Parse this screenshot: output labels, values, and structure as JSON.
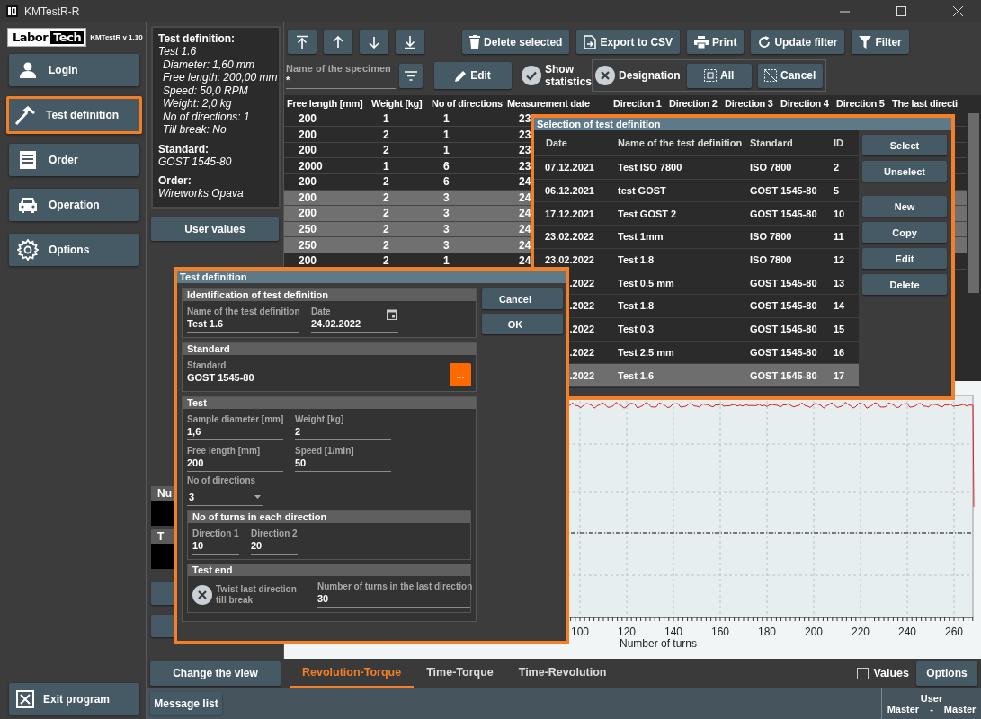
{
  "window": {
    "title": "KMTestR-R"
  },
  "logo": {
    "words": [
      "Labor",
      "Tech"
    ],
    "version": "KMTestR v 1.10"
  },
  "nav": [
    {
      "label": "Login",
      "highlighted": false
    },
    {
      "label": "Test definition",
      "highlighted": true
    },
    {
      "label": "Order",
      "highlighted": false
    },
    {
      "label": "Operation",
      "highlighted": false
    },
    {
      "label": "Options",
      "highlighted": false
    }
  ],
  "exit_button": "Exit program",
  "info_panel": [
    {
      "heading": "Test definition:",
      "value": "Test 1.6",
      "children": [
        "Diameter:  1,60 mm",
        "Free length:  200,00 mm",
        "Speed:  50,0 RPM",
        "Weight:  2,0 kg",
        "No of directions:  1",
        "Till break:  No"
      ]
    },
    {
      "heading": "Standard:",
      "value": "GOST 1545-80"
    },
    {
      "heading": "Order:",
      "value": "Wireworks Opava"
    }
  ],
  "user_values_button": "User values",
  "side_labels": [
    "Nu",
    "T"
  ],
  "toolbar": {
    "buttons": [
      "Delete selected",
      "Export to CSV",
      "Print",
      "Update filter",
      "Filter"
    ]
  },
  "filter_row": {
    "specimen_field": {
      "label": "Name of the specimen",
      "value": "*"
    },
    "edit_button": "Edit",
    "show_statistics": {
      "label": "Show statistics",
      "checked": true
    },
    "designation": {
      "label": "Designation",
      "checked": false
    },
    "all_button": "All",
    "cancel_button": "Cancel"
  },
  "table": {
    "columns": [
      "Free length [mm]",
      "Weight [kg]",
      "No of directions",
      "Measurement date",
      "Direction 1",
      "Direction 2",
      "Direction 3",
      "Direction 4",
      "Direction 5",
      "The last directi"
    ],
    "rows": [
      {
        "cells": [
          "200",
          "1",
          "1",
          "23"
        ],
        "selected": false
      },
      {
        "cells": [
          "200",
          "2",
          "1",
          "23"
        ],
        "selected": false
      },
      {
        "cells": [
          "200",
          "2",
          "1",
          "23"
        ],
        "selected": false
      },
      {
        "cells": [
          "2000",
          "1",
          "6",
          "23"
        ],
        "selected": false
      },
      {
        "cells": [
          "200",
          "2",
          "6",
          "24"
        ],
        "selected": false
      },
      {
        "cells": [
          "200",
          "2",
          "3",
          "24"
        ],
        "selected": true
      },
      {
        "cells": [
          "200",
          "2",
          "3",
          "24"
        ],
        "selected": true
      },
      {
        "cells": [
          "250",
          "2",
          "3",
          "24"
        ],
        "selected": true
      },
      {
        "cells": [
          "250",
          "2",
          "3",
          "24"
        ],
        "selected": true
      },
      {
        "cells": [
          "200",
          "2",
          "1",
          "24"
        ],
        "selected": false
      }
    ]
  },
  "chart": {
    "x_ticks": [
      "100",
      "120",
      "140",
      "160",
      "180",
      "200",
      "220",
      "240",
      "260"
    ],
    "x_label": "Number of turns"
  },
  "view_bar": {
    "change_view_button": "Change the view",
    "tabs": [
      {
        "label": "Revolution-Torque",
        "selected": true
      },
      {
        "label": "Time-Torque",
        "selected": false
      },
      {
        "label": "Time-Revolution",
        "selected": false
      }
    ],
    "values_checkbox": {
      "label": "Values",
      "checked": false
    },
    "options_button": "Options"
  },
  "status_bar": {
    "message_list_button": "Message list",
    "user_label": "User",
    "user_values": [
      "Master",
      "-",
      "Master"
    ]
  },
  "selection_dialog": {
    "title": "Selection of test definition",
    "highlighted": true,
    "columns": [
      "Date",
      "Name of the test definition",
      "Standard",
      "ID"
    ],
    "rows": [
      {
        "date": "07.12.2021",
        "name": "Test ISO 7800",
        "standard": "ISO 7800",
        "id": "2",
        "selected": false
      },
      {
        "date": "06.12.2021",
        "name": "test GOST",
        "standard": "GOST 1545-80",
        "id": "5",
        "selected": false
      },
      {
        "date": "17.12.2021",
        "name": "Test GOST 2",
        "standard": "GOST 1545-80",
        "id": "10",
        "selected": false
      },
      {
        "date": "23.02.2022",
        "name": "Test 1mm",
        "standard": "ISO 7800",
        "id": "11",
        "selected": false
      },
      {
        "date": "23.02.2022",
        "name": "Test 1.8",
        "standard": "ISO 7800",
        "id": "12",
        "selected": false
      },
      {
        "date": ".2022",
        "name": "Test 0.5 mm",
        "standard": "GOST 1545-80",
        "id": "13",
        "selected": false
      },
      {
        "date": ".2022",
        "name": "Test 1.8",
        "standard": "GOST 1545-80",
        "id": "14",
        "selected": false
      },
      {
        "date": ".2022",
        "name": "Test 0.3",
        "standard": "GOST 1545-80",
        "id": "15",
        "selected": false
      },
      {
        "date": ".2022",
        "name": "Test 2.5 mm",
        "standard": "GOST 1545-80",
        "id": "16",
        "selected": false
      },
      {
        "date": ".2022",
        "name": "Test 1.6",
        "standard": "GOST 1545-80",
        "id": "17",
        "selected": true
      }
    ],
    "button_groups": [
      [
        "Select",
        "Unselect"
      ],
      [
        "New",
        "Copy",
        "Edit",
        "Delete"
      ]
    ]
  },
  "test_dialog": {
    "title": "Test definition",
    "highlighted": true,
    "buttons": [
      "Cancel",
      "OK"
    ],
    "identification": {
      "title": "Identification of test definition",
      "name": {
        "label": "Name of the test definition",
        "value": "Test 1.6"
      },
      "date": {
        "label": "Date",
        "value": "24.02.2022"
      }
    },
    "standard": {
      "title": "Standard",
      "field": {
        "label": "Standard",
        "value": "GOST 1545-80"
      },
      "browse_button": "..."
    },
    "test": {
      "title": "Test",
      "fields": [
        {
          "label": "Sample diameter [mm]",
          "value": "1,6"
        },
        {
          "label": "Weight [kg]",
          "value": "2"
        },
        {
          "label": "Free length [mm]",
          "value": "200"
        },
        {
          "label": "Speed [1/min]",
          "value": "50"
        }
      ],
      "directions": {
        "label": "No of directions",
        "value": "3"
      },
      "turns": {
        "title": "No of turns in each direction",
        "fields": [
          {
            "label": "Direction 1",
            "value": "10"
          },
          {
            "label": "Direction 2",
            "value": "20"
          }
        ]
      },
      "end": {
        "title": "Test end",
        "twist": {
          "label": "Twist last direction till break",
          "checked": false
        },
        "last_turns": {
          "label": "Number of turns in the last direction",
          "value": "30"
        }
      }
    }
  }
}
